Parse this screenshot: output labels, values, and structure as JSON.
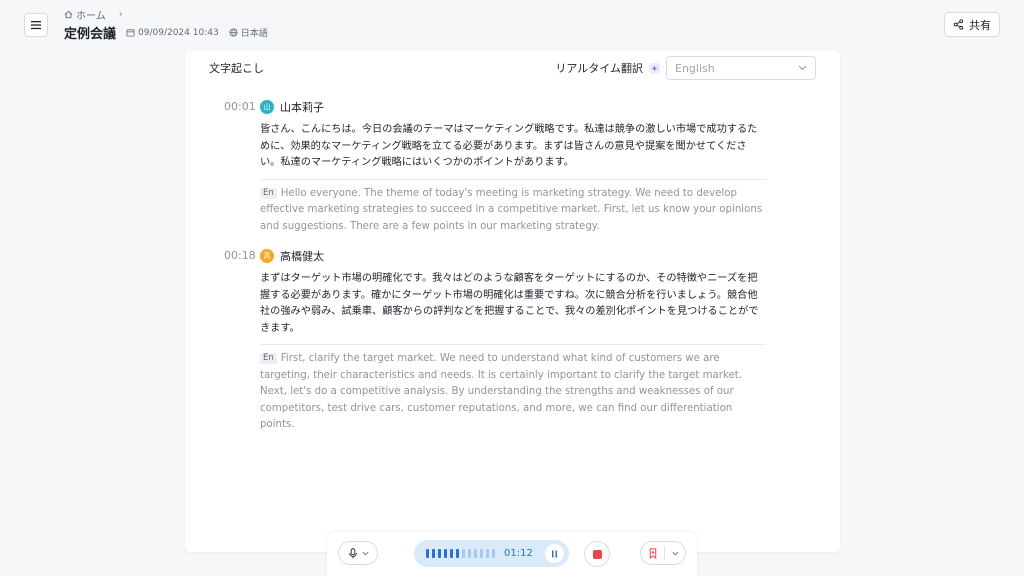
{
  "header": {
    "breadcrumb_home": "ホーム",
    "title": "定例会議",
    "date": "09/09/2024 10:43",
    "language": "日本語",
    "share_label": "共有"
  },
  "card": {
    "section_title": "文字起こし",
    "translate_label": "リアルタイム翻訳",
    "target_language": "English"
  },
  "transcript": [
    {
      "time": "00:01",
      "speaker": "山本莉子",
      "avatar_char": "山",
      "avatar_color": "#2bb3c0",
      "text": "皆さん、こんにちは。今日の会議のテーマはマーケティング戦略です。私達は競争の激しい市場で成功するために、効果的なマーケティング戦略を立てる必要があります。まずは皆さんの意見や提案を聞かせてください。私達のマーケティング戦略にはいくつかのポイントがあります。",
      "lang_tag": "En",
      "translation": "Hello everyone. The theme of today's meeting is marketing strategy. We need to develop effective marketing strategies to succeed in a competitive market. First, let us know your opinions and suggestions. There are a few points in our marketing strategy."
    },
    {
      "time": "00:18",
      "speaker": "高橋健太",
      "avatar_char": "高",
      "avatar_color": "#f5a623",
      "text": "まずはターゲット市場の明確化です。我々はどのような顧客をターゲットにするのか、その特徴やニーズを把握する必要があります。確かにターゲット市場の明確化は重要ですね。次に競合分析を行いましょう。競合他社の強みや弱み、試乗車、顧客からの評判などを把握することで、我々の差別化ポイントを見つけることができます。",
      "lang_tag": "En",
      "translation": "First, clarify the target market. We need to understand what kind of customers we are targeting, their characteristics and needs. It is certainly important to clarify the target market. Next, let's do a competitive analysis. By understanding the strengths and weaknesses of our competitors, test drive cars, customer reputations, and more, we can find our differentiation points."
    }
  ],
  "recorder": {
    "elapsed": "01:12",
    "level_active": 6,
    "level_total": 12,
    "accent_color": "#2b6fcf",
    "stop_color": "#e5484d",
    "bookmark_color": "#e5484d"
  }
}
